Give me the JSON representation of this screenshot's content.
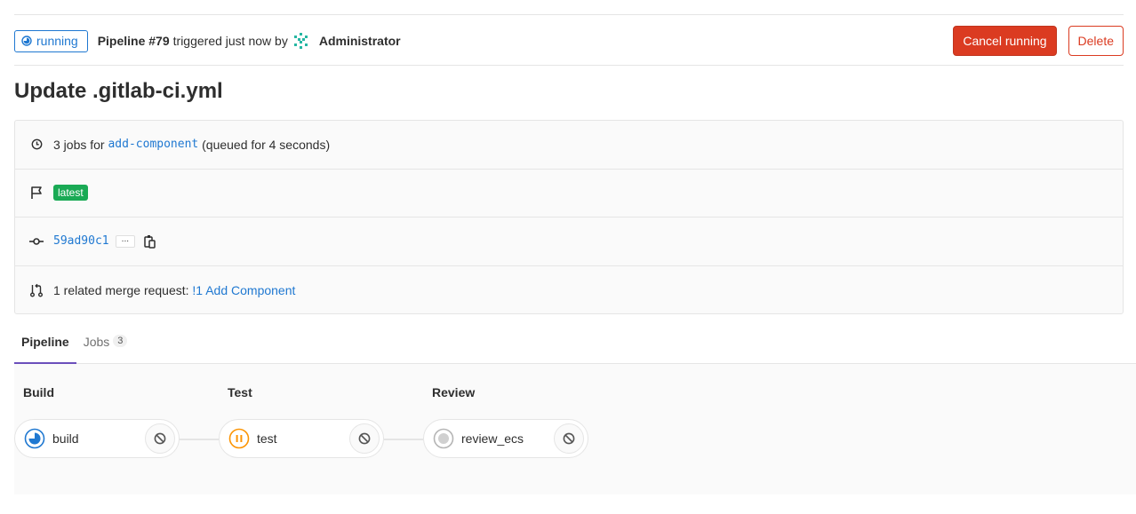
{
  "header": {
    "status_label": "running",
    "pipeline_label": "Pipeline #79",
    "triggered_text": "triggered just now by",
    "user_name": "Administrator",
    "cancel_label": "Cancel running",
    "delete_label": "Delete"
  },
  "title": "Update .gitlab-ci.yml",
  "info": {
    "jobs_text": "3 jobs for",
    "branch": "add-component",
    "queued_text": "(queued for 4 seconds)",
    "badge_label": "latest",
    "commit_sha": "59ad90c1",
    "ellipsis": "···",
    "mr_text": "1 related merge request:",
    "mr_link": "!1 Add Component"
  },
  "tabs": [
    {
      "label": "Pipeline",
      "active": true
    },
    {
      "label": "Jobs",
      "count": "3",
      "active": false
    }
  ],
  "stages": [
    {
      "title": "Build",
      "job": "build",
      "status": "running",
      "icon": "status-running-icon",
      "action": "cancel-icon"
    },
    {
      "title": "Test",
      "job": "test",
      "status": "paused",
      "icon": "status-paused-icon",
      "action": "cancel-icon"
    },
    {
      "title": "Review",
      "job": "review_ecs",
      "status": "created",
      "icon": "status-created-icon",
      "action": "cancel-icon"
    }
  ],
  "colors": {
    "accent": "#1f78d1",
    "danger": "#db3b21",
    "success": "#1aaa55",
    "warning": "#fc9403",
    "tab_active": "#6b4fbb"
  }
}
